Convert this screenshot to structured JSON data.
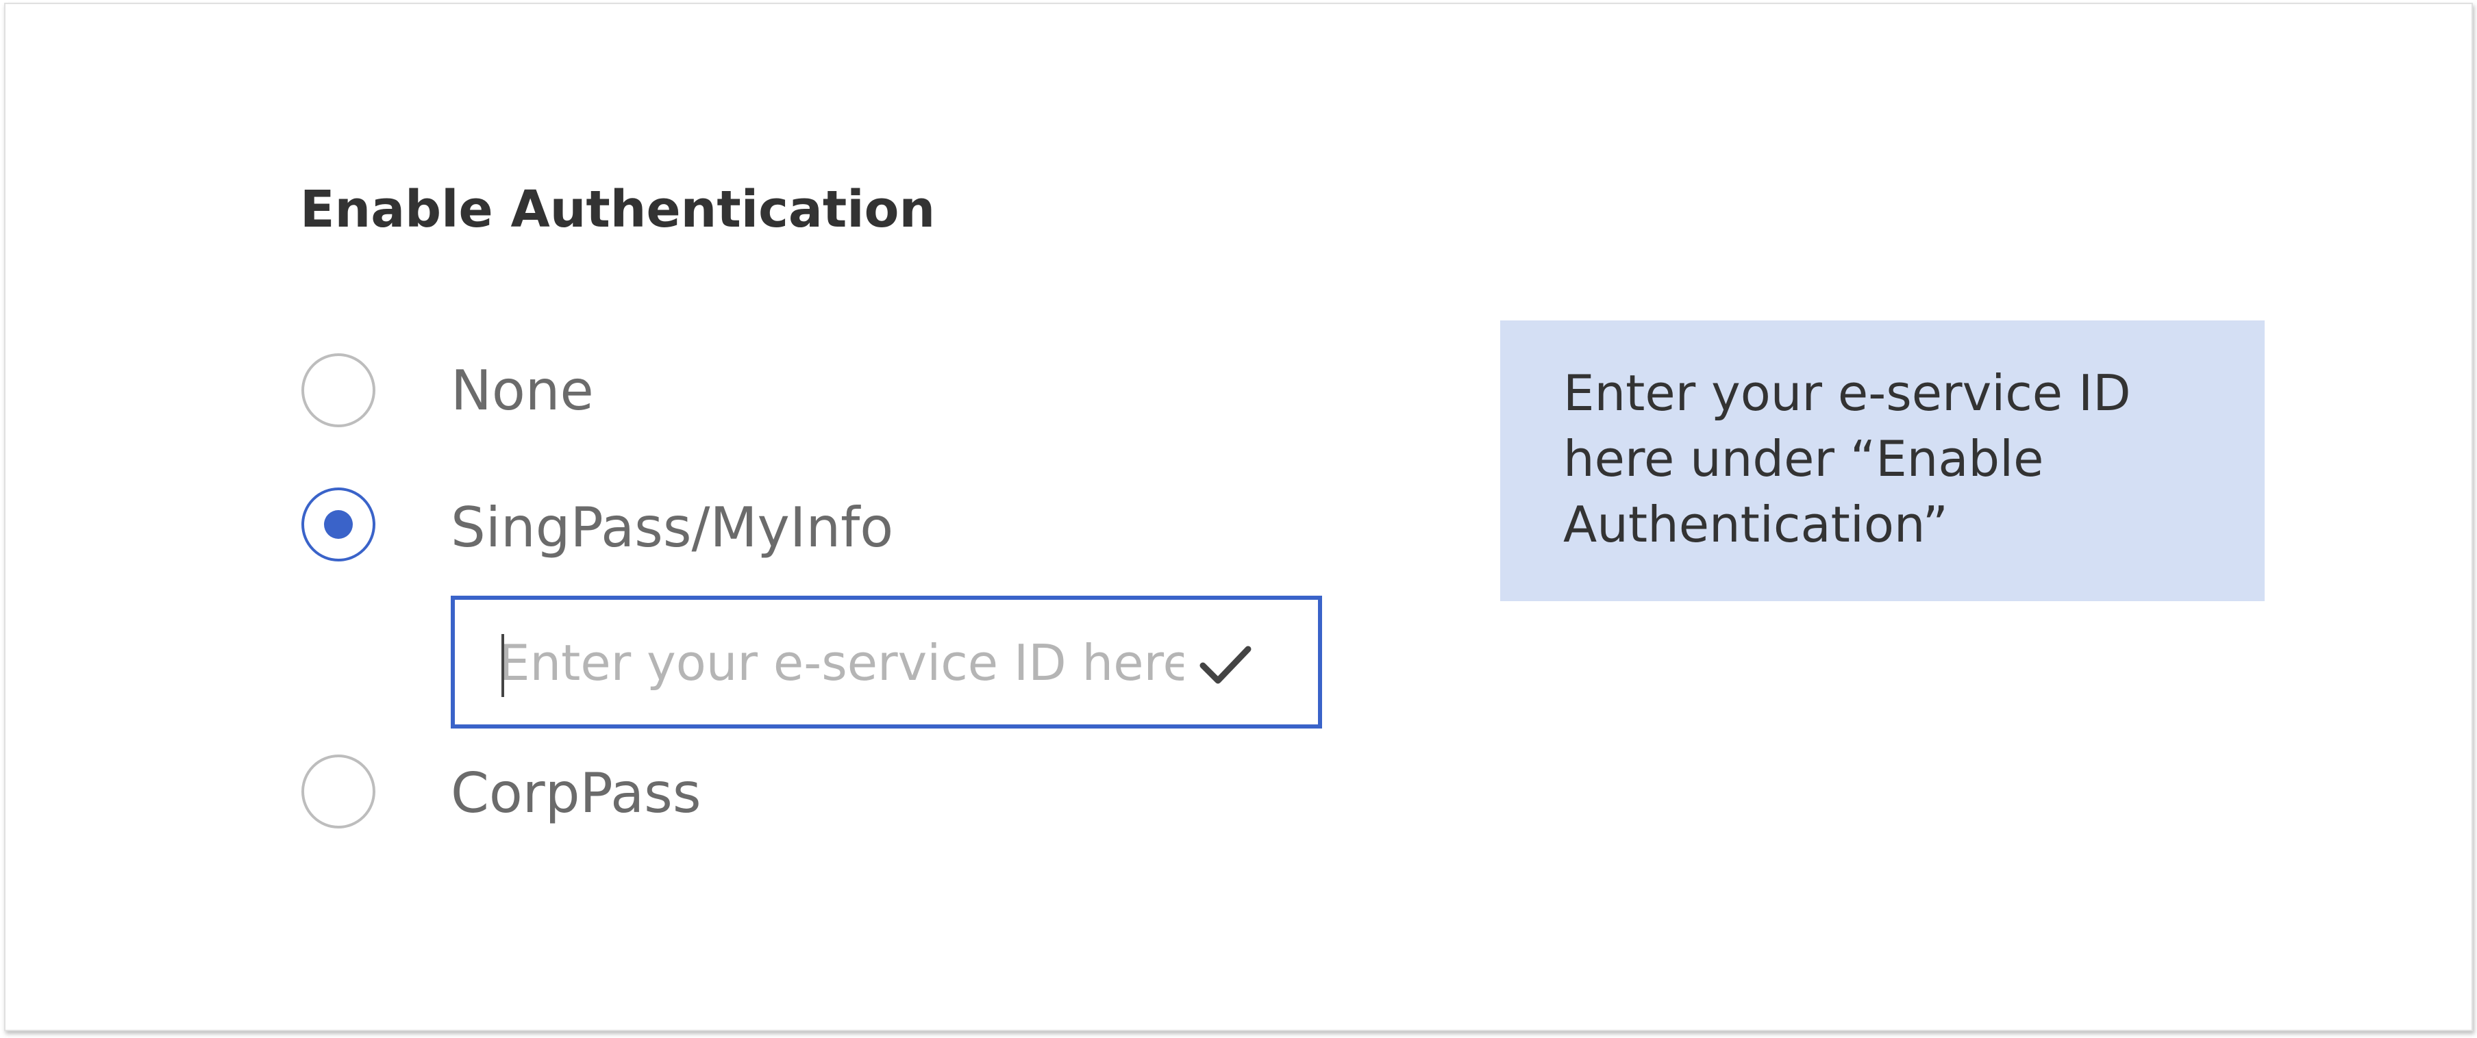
{
  "form": {
    "title": "Enable Authentication",
    "options": [
      {
        "label": "None",
        "selected": false
      },
      {
        "label": "SingPass/MyInfo",
        "selected": true
      },
      {
        "label": "CorpPass",
        "selected": false
      }
    ],
    "eservice_input": {
      "placeholder": "Enter your e-service ID here",
      "value": ""
    },
    "confirm_icon": "checkmark-icon"
  },
  "callout": {
    "text": "Enter your e-service ID here under “Enable Authentication”"
  },
  "colors": {
    "accent": "#3a63c9",
    "callout_bg": "#d4dff4",
    "label_text": "#6b6b6b",
    "placeholder_text": "#b5b5b5",
    "radio_border": "#bdbdbd"
  }
}
